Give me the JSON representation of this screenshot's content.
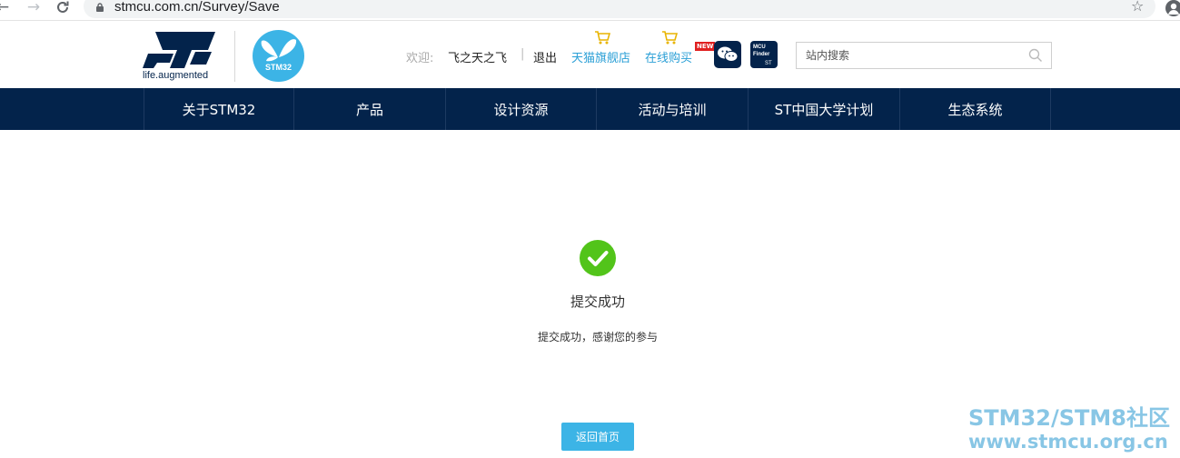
{
  "browser": {
    "url": "stmcu.com.cn/Survey/Save"
  },
  "header": {
    "logo_tagline": "life.augmented",
    "stm32_badge": "STM32",
    "welcome_label": "欢迎:",
    "username": "飞之天之飞",
    "separator": "|",
    "logout_label": "退出",
    "tmall_label": "天猫旗舰店",
    "buy_label": "在线购买",
    "new_badge": "NEW",
    "mcu_finder_title": "MCU Finder",
    "mcu_finder_brand": "ST",
    "search_placeholder": "站内搜索"
  },
  "nav": {
    "items": [
      {
        "label": "关于STM32"
      },
      {
        "label": "产品"
      },
      {
        "label": "设计资源"
      },
      {
        "label": "活动与培训"
      },
      {
        "label": "ST中国大学计划"
      },
      {
        "label": "生态系统"
      }
    ]
  },
  "content": {
    "title": "提交成功",
    "description": "提交成功，感谢您的参与",
    "home_button": "返回首页"
  },
  "watermark": {
    "line1": "STM32/STM8社区",
    "line2": "www.stmcu.org.cn"
  },
  "colors": {
    "nav_bg": "#03234b",
    "accent": "#3cb4e6",
    "success": "#52c41a",
    "link": "#2a9fd6"
  }
}
